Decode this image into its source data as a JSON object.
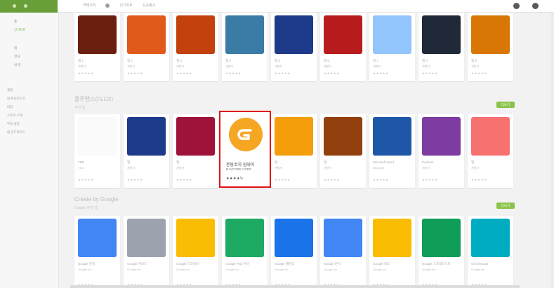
{
  "topbar": {
    "nav_items": [
      "카테고리",
      "인기차트",
      "신규출시"
    ],
    "right_icons": [
      "settings-icon",
      "account-icon"
    ]
  },
  "sidebar": {
    "sub_items": [
      "홈",
      "인기차트"
    ],
    "group1": [
      "앱",
      "영화",
      "내 앱"
    ],
    "group2": [
      "계정",
      "내 위시리스트",
      "리딤",
      "스토어 구매",
      "부모 설정",
      "내 안드로이드"
    ]
  },
  "sections": [
    {
      "apps": [
        {
          "title": "앱 1",
          "dev": "개발자",
          "stars": "★★★★★"
        },
        {
          "title": "앱 2",
          "dev": "개발자",
          "stars": "★★★★★"
        },
        {
          "title": "앱 3",
          "dev": "개발자",
          "stars": "★★★★★"
        },
        {
          "title": "앱 4",
          "dev": "개발자",
          "stars": "★★★★★"
        },
        {
          "title": "앱 5",
          "dev": "개발자",
          "stars": "★★★★★"
        },
        {
          "title": "앱 6",
          "dev": "개발자",
          "stars": "★★★★★"
        },
        {
          "title": "앱 7",
          "dev": "개발자",
          "stars": "★★★★★"
        },
        {
          "title": "앱 8",
          "dev": "개발자",
          "stars": "★★★★★"
        },
        {
          "title": "앱 9",
          "dev": "개발자",
          "stars": "★★★★★"
        }
      ]
    },
    {
      "title": "플루랩스(FLUX)",
      "subtitle": "추천 앱",
      "more_label": "더보기",
      "apps": [
        {
          "title": "TED",
          "dev": "TED",
          "stars": "★★★★★"
        },
        {
          "title": "앱",
          "dev": "개발자",
          "stars": "★★★★★"
        },
        {
          "title": "앱",
          "dev": "개발자",
          "stars": "★★★★★"
        },
        {
          "title": "운동코치 짐데이",
          "dev": "DAYCORE CORP",
          "stars": "★★★★½"
        },
        {
          "title": "앱",
          "dev": "개발자",
          "stars": "★★★★★"
        },
        {
          "title": "앱",
          "dev": "개발자",
          "stars": "★★★★★"
        },
        {
          "title": "Microsoft Word",
          "dev": "Microsoft",
          "stars": "★★★★★"
        },
        {
          "title": "Podcast",
          "dev": "개발자",
          "stars": "★★★★★"
        },
        {
          "title": "앱",
          "dev": "개발자",
          "stars": "★★★★★"
        }
      ]
    },
    {
      "title": "Create by Google",
      "subtitle": "Google 추천 앱",
      "more_label": "더보기",
      "apps": [
        {
          "title": "Google 번역",
          "dev": "Google Inc.",
          "stars": "★★★★★"
        },
        {
          "title": "Google 키보드",
          "dev": "Google Inc.",
          "stars": "★★★★★"
        },
        {
          "title": "Google 드라이브",
          "dev": "Google Inc.",
          "stars": "★★★★★"
        },
        {
          "title": "Google Play 무비",
          "dev": "Google Inc.",
          "stars": "★★★★★"
        },
        {
          "title": "Google 캘린더",
          "dev": "Google Inc.",
          "stars": "★★★★★"
        },
        {
          "title": "Google 문서",
          "dev": "Google Inc.",
          "stars": "★★★★★"
        },
        {
          "title": "Google 포토",
          "dev": "Google Inc.",
          "stars": "★★★★★"
        },
        {
          "title": "Google 스프레드시트",
          "dev": "Google Inc.",
          "stars": "★★★★★"
        },
        {
          "title": "Chromecast",
          "dev": "Google Inc.",
          "stars": "★★★★★"
        }
      ]
    }
  ],
  "highlighted_app": {
    "name": "운동코치 짐데이",
    "developer": "DAYCORE CORP",
    "stars": "★★★★½",
    "icon_letter": "G"
  },
  "colors": {
    "brand_green": "#689f38",
    "accent_green": "#8bc34a",
    "highlight_red": "#e11414",
    "app_orange": "#f5a623"
  }
}
